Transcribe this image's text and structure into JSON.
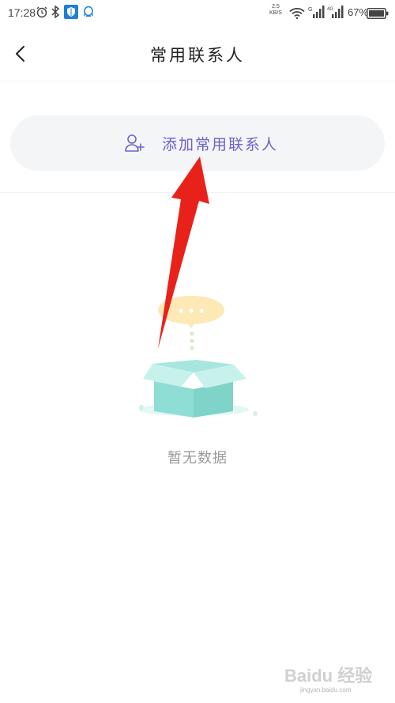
{
  "status_bar": {
    "time": "17:28",
    "net_speed_value": "2.5",
    "net_speed_unit": "KB/S",
    "signal1_label": "G",
    "signal2_label": "4G",
    "battery": "67%"
  },
  "nav": {
    "title": "常用联系人"
  },
  "add_contact": {
    "label": "添加常用联系人"
  },
  "empty_state": {
    "text": "暂无数据"
  },
  "watermark": {
    "brand": "Baidu 经验",
    "url": "jingyan.baidu.com"
  },
  "colors": {
    "accent": "#6b63c9",
    "pill_bg": "#f4f5f7",
    "empty_text": "#9a9a9a",
    "arrow": "#e8221b",
    "box": "#8fded5",
    "bubble": "#fde9b5"
  }
}
